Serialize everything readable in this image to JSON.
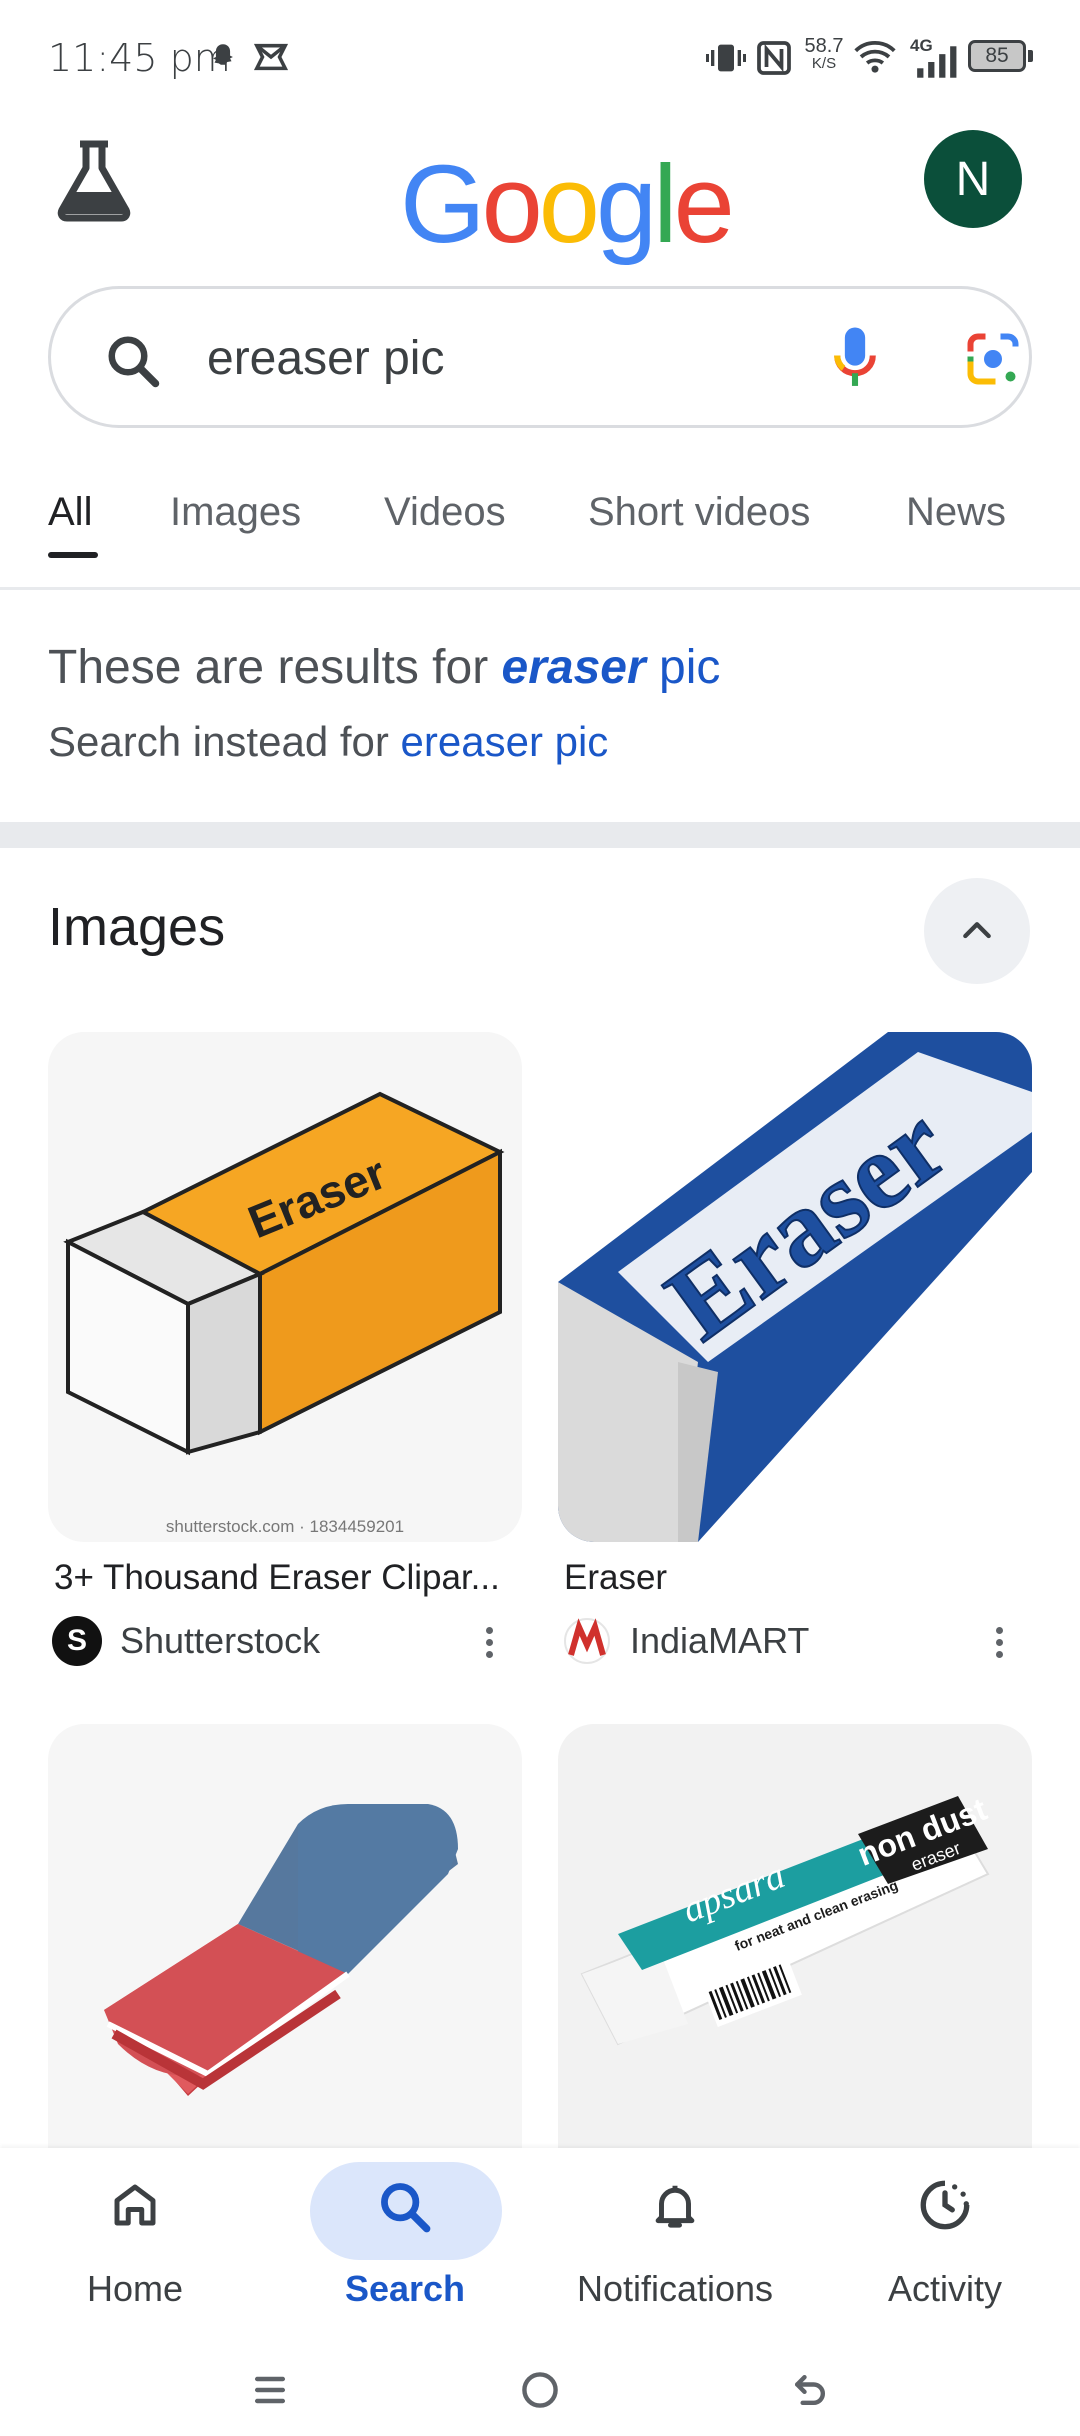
{
  "status_bar": {
    "time": "11:45 pm",
    "network_speed": "58.7",
    "network_speed_unit": "K/S",
    "network_type": "4G",
    "battery": "85"
  },
  "header": {
    "logo_text": "Google",
    "avatar_initial": "N"
  },
  "search": {
    "query": "ereaser pic"
  },
  "tabs": [
    {
      "label": "All",
      "active": true
    },
    {
      "label": "Images"
    },
    {
      "label": "Videos"
    },
    {
      "label": "Short videos"
    },
    {
      "label": "News"
    }
  ],
  "spelling": {
    "prefix": "These are results for ",
    "corrected_word": "eraser",
    "corrected_rest": " pic",
    "instead_prefix": "Search instead for ",
    "instead_link": "ereaser pic"
  },
  "images_section": {
    "title": "Images",
    "results": [
      {
        "caption": "3+ Thousand Eraser Clipar...",
        "source": "Shutterstock",
        "watermark": "shutterstock.com · 1834459201",
        "image_text": "Eraser"
      },
      {
        "caption": "Eraser",
        "source": "IndiaMART",
        "image_text": "Eraser"
      },
      {
        "caption": "",
        "source": ""
      },
      {
        "caption": "",
        "source": "",
        "image_text_1": "apsara",
        "image_text_2": "non dust",
        "image_text_3": "eraser",
        "image_text_4": "for neat and clean erasing"
      }
    ]
  },
  "bottom_nav": {
    "items": [
      {
        "label": "Home"
      },
      {
        "label": "Search",
        "active": true
      },
      {
        "label": "Notifications"
      },
      {
        "label": "Activity"
      }
    ]
  },
  "colors": {
    "google_blue": "#4285F4",
    "google_red": "#EA4335",
    "google_yellow": "#FBBC05",
    "google_green": "#34A853",
    "link_blue": "#1a57c8",
    "avatar_green": "#0b4f3a"
  }
}
